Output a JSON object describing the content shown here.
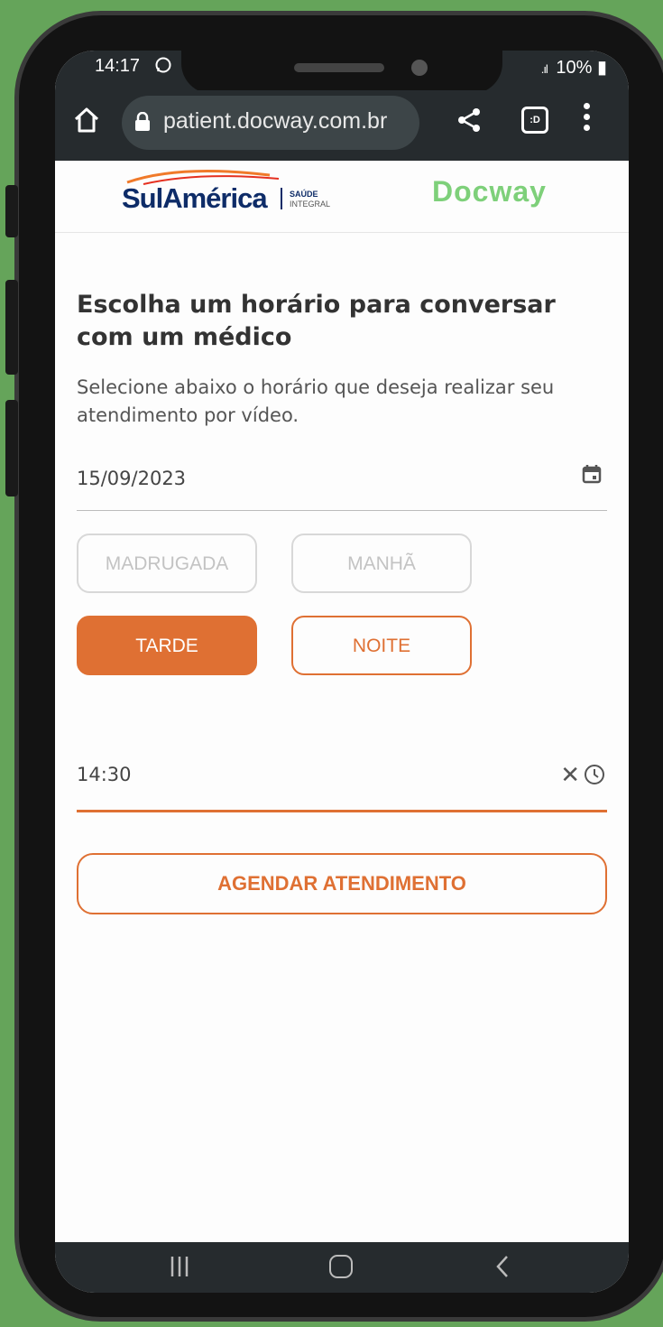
{
  "status_bar": {
    "time": "14:17",
    "notification_icons": [
      "whatsapp-icon"
    ],
    "signal": ".ıl",
    "battery": "10%"
  },
  "browser": {
    "url": "patient.docway.com.br",
    "tabs_label": ":D"
  },
  "header": {
    "sulamerica_logo": "SulAmérica",
    "sulamerica_sub_1": "SAÚDE",
    "sulamerica_sub_2": "INTEGRAL",
    "docway_logo": "Docway"
  },
  "content": {
    "title": "Escolha um horário para conversar com um médico",
    "subtitle": "Selecione abaixo o horário que deseja realizar seu atendimento por vídeo.",
    "date_value": "15/09/2023",
    "periods": [
      {
        "label": "MADRUGADA",
        "state": "disabled"
      },
      {
        "label": "MANHÃ",
        "state": "disabled"
      },
      {
        "label": "TARDE",
        "state": "selected"
      },
      {
        "label": "NOITE",
        "state": "available"
      }
    ],
    "time_value": "14:30",
    "schedule_button": "AGENDAR ATENDIMENTO"
  },
  "colors": {
    "accent": "#df7033",
    "brand_blue": "#0e2c68",
    "docway_green": "#7ed07a",
    "background": "#65a45a"
  }
}
